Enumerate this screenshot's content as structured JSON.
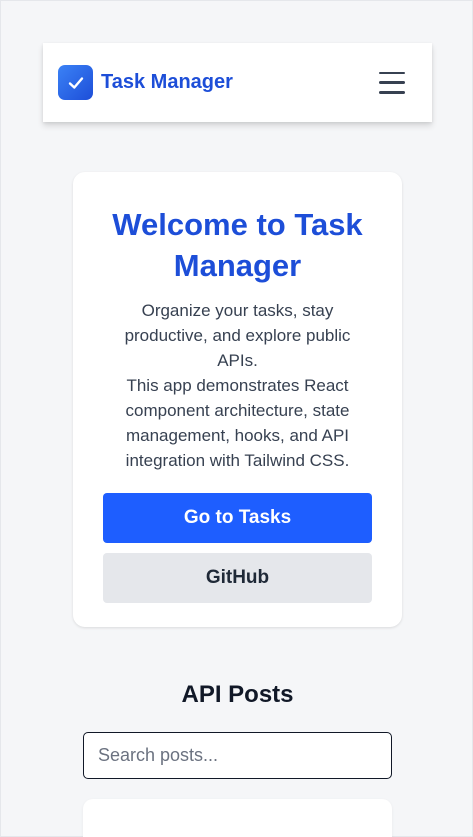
{
  "navbar": {
    "title": "Task Manager",
    "logo_icon": "check-icon",
    "menu_icon": "hamburger-menu-icon",
    "brand_color": "#1d4ed8"
  },
  "hero": {
    "heading": "Welcome to Task Manager",
    "description_line1": "Organize your tasks, stay productive, and explore public APIs.",
    "description_line2": "This app demonstrates React component architecture, state management, hooks, and API integration with Tailwind CSS.",
    "primary_button": "Go to Tasks",
    "secondary_button": "GitHub"
  },
  "posts": {
    "title": "API Posts",
    "search_placeholder": "Search posts..."
  },
  "colors": {
    "accent": "#1e5eff",
    "background": "#f5f6f8"
  }
}
